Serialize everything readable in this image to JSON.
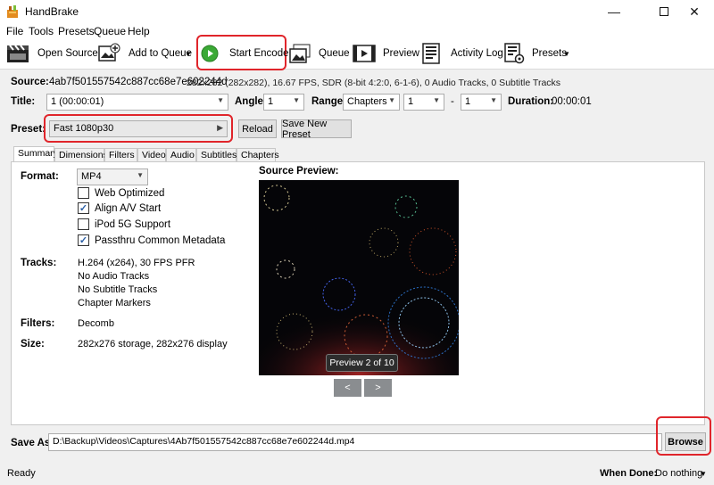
{
  "window": {
    "title": "HandBrake"
  },
  "menu": [
    "File",
    "Tools",
    "Presets",
    "Queue",
    "Help"
  ],
  "toolbar": {
    "open_source": "Open Source",
    "add_to_queue": "Add to Queue",
    "start_encode": "Start Encode",
    "queue": "Queue",
    "preview": "Preview",
    "activity_log": "Activity Log",
    "presets": "Presets"
  },
  "source": {
    "label": "Source:",
    "name": "4ab7f501557542c887cc68e7e602244d",
    "info": "282x282 (282x282), 16.67 FPS, SDR (8-bit 4:2:0, 6-1-6), 0 Audio Tracks, 0 Subtitle Tracks"
  },
  "title_row": {
    "title_label": "Title:",
    "title_value": "1 (00:00:01)",
    "angle_label": "Angle:",
    "angle_value": "1",
    "range_label": "Range:",
    "range_value": "Chapters",
    "range_start": "1",
    "range_dash": "-",
    "range_end": "1",
    "duration_label": "Duration:",
    "duration_value": "00:00:01"
  },
  "preset": {
    "label": "Preset:",
    "value": "Fast 1080p30",
    "reload": "Reload",
    "save_new": "Save New Preset"
  },
  "tabs": [
    "Summary",
    "Dimensions",
    "Filters",
    "Video",
    "Audio",
    "Subtitles",
    "Chapters"
  ],
  "summary": {
    "format_label": "Format:",
    "format_value": "MP4",
    "options": [
      {
        "label": "Web Optimized",
        "checked": false
      },
      {
        "label": "Align A/V Start",
        "checked": true
      },
      {
        "label": "iPod 5G Support",
        "checked": false
      },
      {
        "label": "Passthru Common Metadata",
        "checked": true
      }
    ],
    "tracks_label": "Tracks:",
    "tracks": [
      "H.264 (x264), 30 FPS PFR",
      "No Audio Tracks",
      "No Subtitle Tracks",
      "Chapter Markers"
    ],
    "filters_label": "Filters:",
    "filters_value": "Decomb",
    "size_label": "Size:",
    "size_value": "282x276 storage, 282x276 display"
  },
  "preview": {
    "label": "Source Preview:",
    "caption": "Preview 2 of 10",
    "prev": "<",
    "next": ">"
  },
  "save": {
    "label": "Save As:",
    "path": "D:\\Backup\\Videos\\Captures\\4Ab7f501557542c887cc68e7e602244d.mp4",
    "browse": "Browse"
  },
  "status": {
    "text": "Ready",
    "when_done_label": "When Done:",
    "when_done_value": "Do nothing"
  },
  "colors": {
    "highlight": "#e0252b",
    "play_green": "#3aa935"
  }
}
